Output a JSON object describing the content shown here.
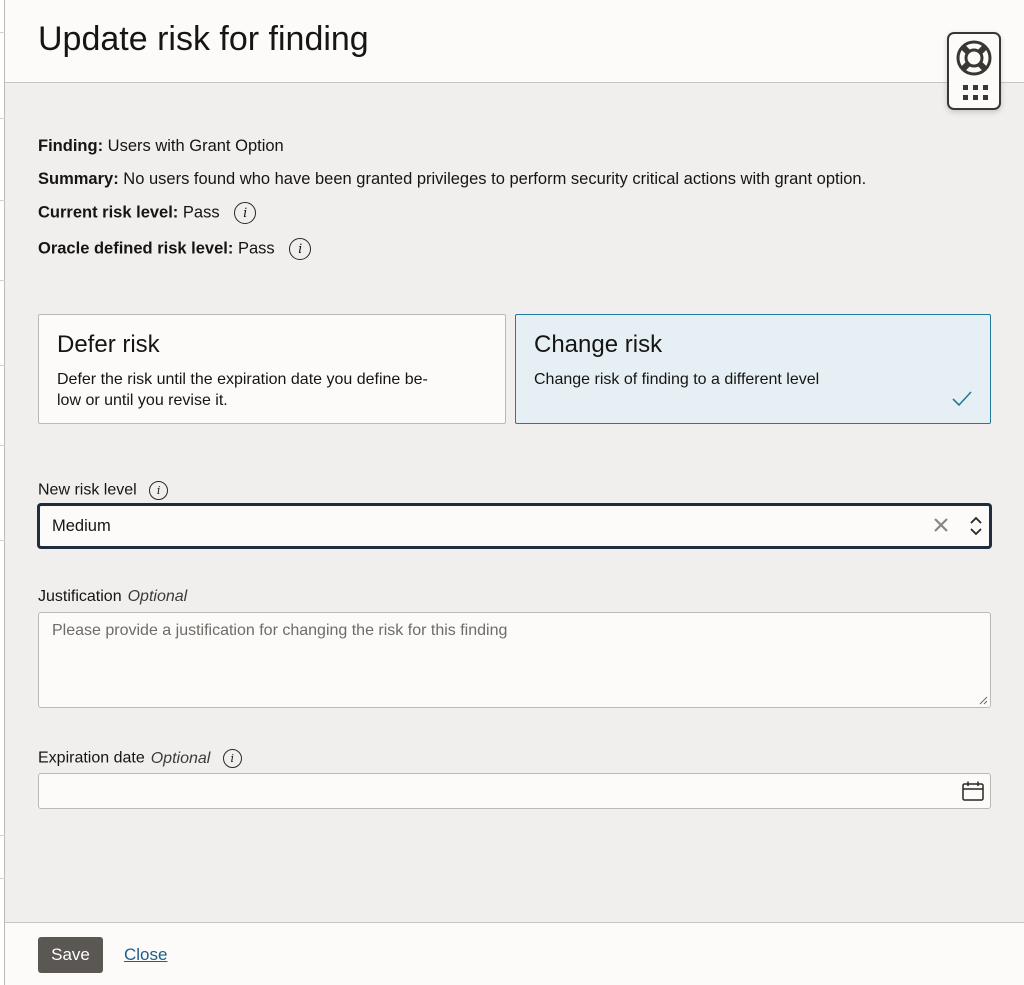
{
  "dialog": {
    "title": "Update risk for finding"
  },
  "info": {
    "finding_label": "Finding:",
    "finding_value": "Users with Grant Option",
    "summary_label": "Summary:",
    "summary_value": "No users found who have been granted privileges to perform security critical actions with grant option.",
    "current_label": "Current risk level:",
    "current_value": "Pass",
    "oracle_label": "Oracle defined risk level:",
    "oracle_value": "Pass",
    "info_icon_glyph": "i"
  },
  "options": {
    "defer": {
      "title": "Defer risk",
      "description_line1": "Defer the risk until the expiration date you define be-",
      "description_line2": "low or until you revise it."
    },
    "change": {
      "title": "Change risk",
      "description": "Change risk of finding to a different level",
      "selected": true
    }
  },
  "new_risk": {
    "label": "New risk level",
    "value": "Medium"
  },
  "justification": {
    "label": "Justification",
    "optional": "Optional",
    "placeholder": "Please provide a justification for changing the risk for this finding"
  },
  "expiration": {
    "label": "Expiration date",
    "optional": "Optional",
    "value": ""
  },
  "footer": {
    "save_label": "Save",
    "close_label": "Close"
  },
  "colors": {
    "selected_card_bg": "#e6f0f4",
    "selected_card_border": "#227a9c",
    "save_button": "#5b5752",
    "link": "#1d5e8a"
  },
  "icons": [
    "lifebuoy-icon",
    "app-grid-icon",
    "info-icon",
    "checkmark-icon",
    "clear-icon",
    "sort-updown-icon",
    "resize-handle-icon",
    "calendar-icon"
  ]
}
